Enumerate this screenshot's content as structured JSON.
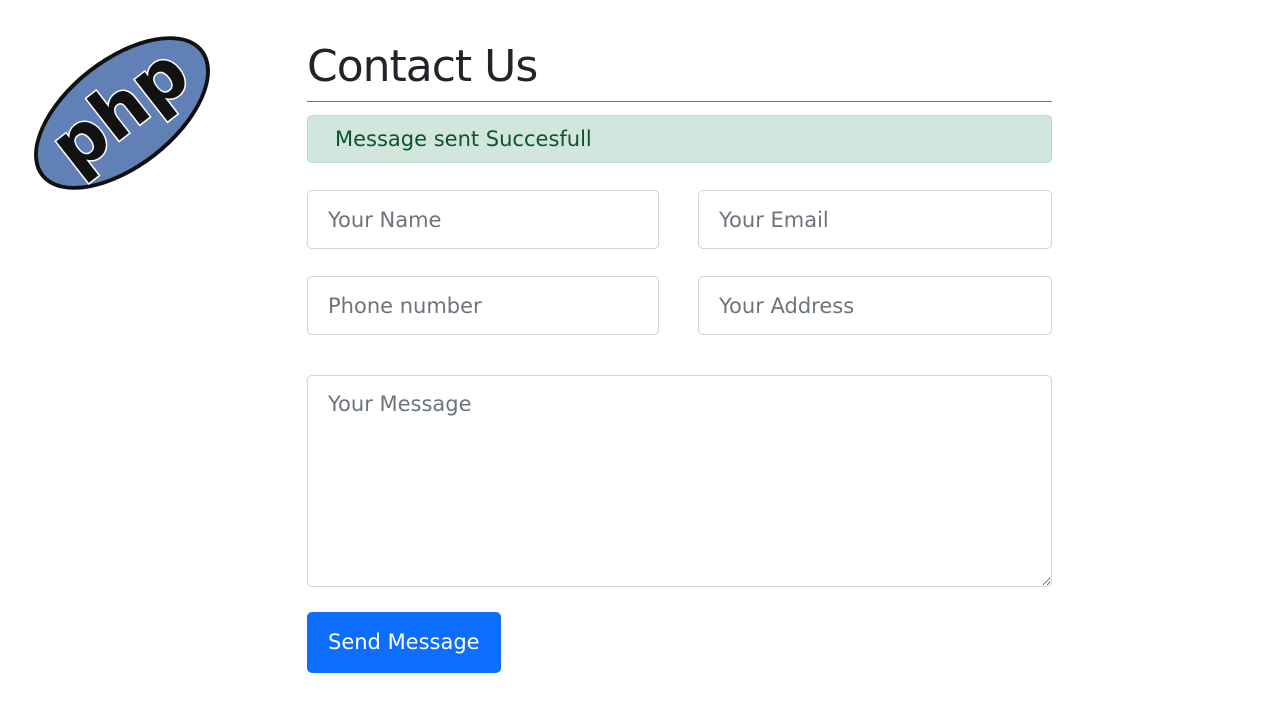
{
  "logo": {
    "text": "php",
    "icon": "php-logo-icon"
  },
  "page": {
    "title": "Contact Us"
  },
  "alert": {
    "text": "Message sent Succesfull",
    "type": "success"
  },
  "form": {
    "name_placeholder": "Your Name",
    "email_placeholder": "Your Email",
    "phone_placeholder": "Phone number",
    "address_placeholder": "Your Address",
    "message_placeholder": "Your Message",
    "name_value": "",
    "email_value": "",
    "phone_value": "",
    "address_value": "",
    "message_value": "",
    "submit_label": "Send Message"
  },
  "colors": {
    "primary": "#0d6efd",
    "success_bg": "#d1e7dd",
    "success_text": "#0f5132",
    "logo_fill": "#6181b6",
    "border": "#ced4da"
  }
}
